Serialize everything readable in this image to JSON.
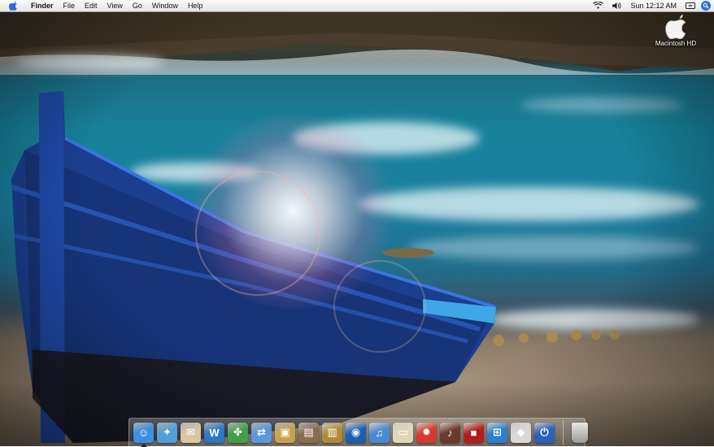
{
  "menubar": {
    "app": "Finder",
    "menus": [
      "File",
      "Edit",
      "View",
      "Go",
      "Window",
      "Help"
    ],
    "clock": "Sun 12:12 AM",
    "status_icons": [
      "wifi-icon",
      "volume-icon"
    ],
    "spotlight_icon": "spotlight-icon"
  },
  "desktop": {
    "hd_label": "Macintosh HD"
  },
  "dock": {
    "apps": [
      {
        "icon": "finder-icon",
        "color": "#3d8fe0"
      },
      {
        "icon": "safari-icon",
        "color": "#4f9fd8"
      },
      {
        "icon": "mail-icon",
        "color": "#d9c7a0"
      },
      {
        "icon": "itunes-wu-icon",
        "color": "#2c7ac4"
      },
      {
        "icon": "app-green-icon",
        "color": "#43a047"
      },
      {
        "icon": "migration-icon",
        "color": "#5a9ad8"
      },
      {
        "icon": "iphoto-icon",
        "color": "#c9a14e"
      },
      {
        "icon": "preview-icon",
        "color": "#8a6d4a"
      },
      {
        "icon": "notebook-icon",
        "color": "#b08a3a"
      },
      {
        "icon": "dvd-player-icon",
        "color": "#1b5fb5"
      },
      {
        "icon": "itunes-icon",
        "color": "#4a8ad0"
      },
      {
        "icon": "scanner-icon",
        "color": "#e2d6b8"
      },
      {
        "icon": "popcorn-icon",
        "color": "#d63a2e"
      },
      {
        "icon": "guitar-icon",
        "color": "#6a3a2a"
      },
      {
        "icon": "photo-booth-icon",
        "color": "#b21e1e"
      },
      {
        "icon": "windows-icon",
        "color": "#2b7fd0"
      },
      {
        "icon": "apple-system-icon",
        "color": "#d8d8d8"
      },
      {
        "icon": "shutdown-icon",
        "color": "#2c63b8"
      }
    ],
    "trash_icon": "trash-icon"
  }
}
